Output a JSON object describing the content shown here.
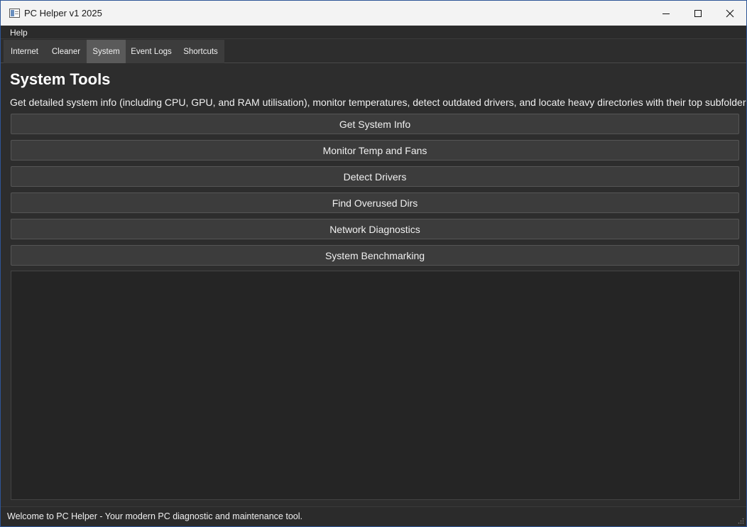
{
  "window": {
    "title": "PC Helper v1 2025"
  },
  "menu": {
    "items": [
      "Help"
    ]
  },
  "tabs": [
    {
      "label": "Internet",
      "active": false
    },
    {
      "label": "Cleaner",
      "active": false
    },
    {
      "label": "System",
      "active": true
    },
    {
      "label": "Event Logs",
      "active": false
    },
    {
      "label": "Shortcuts",
      "active": false
    }
  ],
  "main": {
    "heading": "System Tools",
    "description": "Get detailed system info (including CPU, GPU, and RAM utilisation), monitor temperatures, detect outdated drivers, and locate heavy directories with their top subfolders.",
    "buttons": [
      "Get System Info",
      "Monitor Temp and Fans",
      "Detect Drivers",
      "Find Overused Dirs",
      "Network Diagnostics",
      "System Benchmarking"
    ],
    "output": ""
  },
  "status": {
    "text": "Welcome to PC Helper - Your modern PC diagnostic and maintenance tool."
  },
  "icons": {
    "app": "app-window-icon",
    "minimize": "minimize-icon",
    "maximize": "maximize-icon",
    "close": "close-icon",
    "grip": "resize-grip-icon"
  },
  "colors": {
    "titlebar": "#f3f3f3",
    "background": "#2d2d2d",
    "tab_active": "#5a5a5a",
    "button": "#3c3c3c",
    "output": "#252525"
  }
}
